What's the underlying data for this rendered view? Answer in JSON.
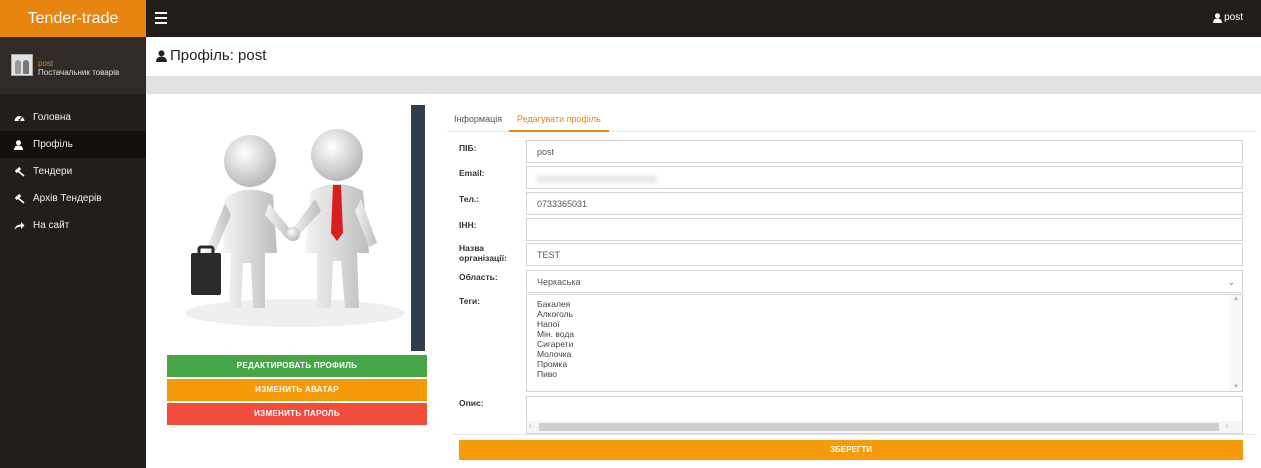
{
  "app": {
    "brand": "Tender-trade",
    "top_user": "post"
  },
  "sidebar": {
    "user_name": "post",
    "user_role": "Постачальник товарів",
    "items": [
      {
        "label": "Головна",
        "icon": "dashboard-icon",
        "active": false
      },
      {
        "label": "Профіль",
        "icon": "user-icon",
        "active": true
      },
      {
        "label": "Тендери",
        "icon": "gavel-icon",
        "active": false
      },
      {
        "label": "Архів Тендерів",
        "icon": "gavel-icon",
        "active": false
      },
      {
        "label": "На сайт",
        "icon": "share-arrow-icon",
        "active": false
      }
    ]
  },
  "page": {
    "title": "Профіль: post"
  },
  "buttons": {
    "edit_profile": "РЕДАКТИРОВАТЬ ПРОФИЛЬ",
    "change_avatar": "ИЗМЕНИТЬ АВАТАР",
    "change_password": "ИЗМЕНИТЬ ПАРОЛЬ",
    "save": "ЗБЕРЕГТИ"
  },
  "tabs": [
    {
      "label": "Інформація",
      "active": false
    },
    {
      "label": "Редагувати профіль",
      "active": true
    }
  ],
  "form": {
    "pib": {
      "label": "ПІБ:",
      "value": "post"
    },
    "email": {
      "label": "Email:",
      "value": ""
    },
    "tel": {
      "label": "Тел.:",
      "value": "0733365031"
    },
    "inn": {
      "label": "ІНН:",
      "value": ""
    },
    "org": {
      "label": "Назва організації:",
      "value": "TEST"
    },
    "oblast": {
      "label": "Область:",
      "value": "Черкаська"
    },
    "tags": {
      "label": "Теги:",
      "options": [
        "Бакалея",
        "Алкоголь",
        "Напої",
        "Мін. вода",
        "Сигарети",
        "Молочка",
        "Промка",
        "Пиво"
      ]
    },
    "desc": {
      "label": "Опис:",
      "value": ""
    }
  },
  "colors": {
    "brand": "#e88511",
    "dark": "#231e1b",
    "green": "#46a546",
    "orange": "#f59b0b",
    "red": "#f14d3c"
  }
}
